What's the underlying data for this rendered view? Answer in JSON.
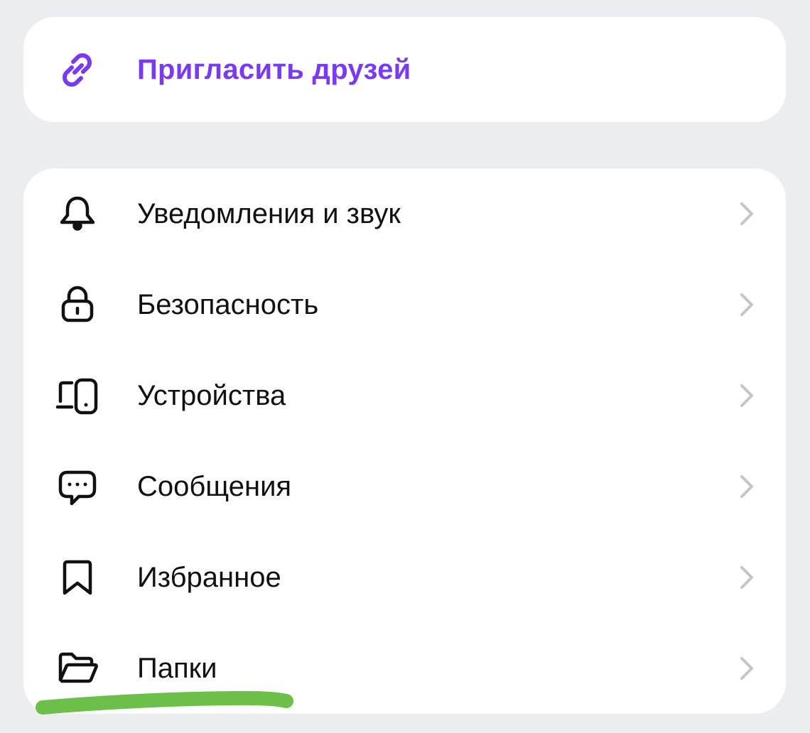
{
  "invite": {
    "label": "Пригласить друзей",
    "icon": "link-icon",
    "accent_color": "#7A3AF0"
  },
  "settings": {
    "items": [
      {
        "label": "Уведомления и звук",
        "icon": "bell-icon"
      },
      {
        "label": "Безопасность",
        "icon": "lock-icon"
      },
      {
        "label": "Устройства",
        "icon": "devices-icon"
      },
      {
        "label": "Сообщения",
        "icon": "chat-bubble-icon"
      },
      {
        "label": "Избранное",
        "icon": "bookmark-icon"
      },
      {
        "label": "Папки",
        "icon": "folder-icon"
      }
    ]
  },
  "colors": {
    "background": "#ECEDF1",
    "card": "#FFFFFF",
    "text": "#111111",
    "chevron": "#C4C4C9",
    "highlight": "#6CC04A"
  }
}
